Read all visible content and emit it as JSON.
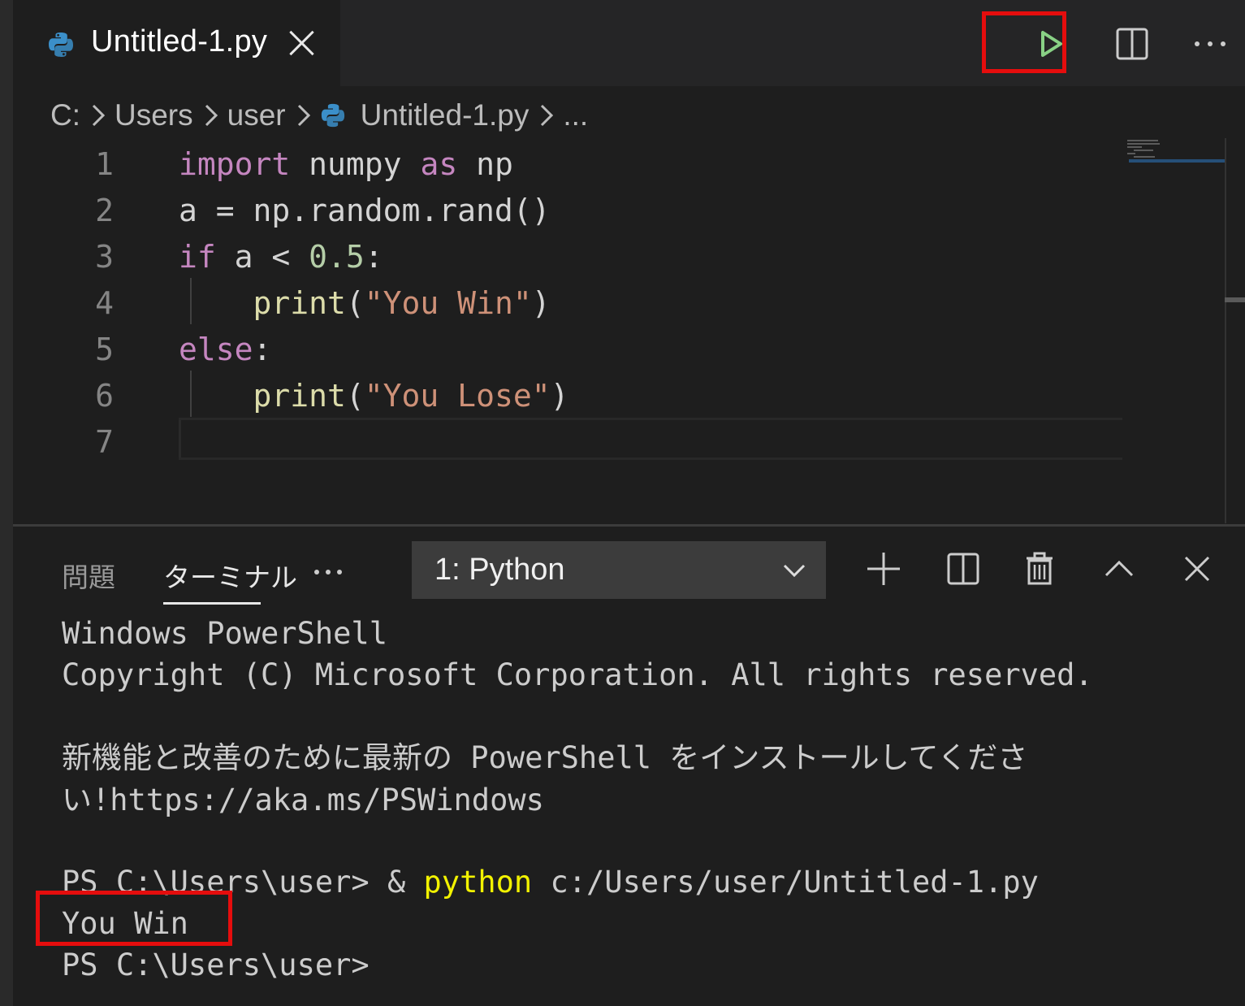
{
  "editor_tab": {
    "title": "Untitled-1.py"
  },
  "breadcrumb": [
    "C:",
    "Users",
    "user",
    "Untitled-1.py",
    "..."
  ],
  "code": {
    "line_numbers": [
      "1",
      "2",
      "3",
      "4",
      "5",
      "6",
      "7"
    ],
    "tokens": {
      "l1_import": "import",
      "l1_numpy": "numpy",
      "l1_as": "as",
      "l1_np": "np",
      "l2_text": "a = np.random.rand()",
      "l3_if": "if",
      "l3_cond": "a < ",
      "l3_num": "0.5",
      "l3_colon": ":",
      "l4_print": "print",
      "l4_open": "(",
      "l4_str": "\"You Win\"",
      "l4_close": ")",
      "l5_else": "else",
      "l5_colon": ":",
      "l6_print": "print",
      "l6_open": "(",
      "l6_str": "\"You Lose\"",
      "l6_close": ")"
    }
  },
  "panel": {
    "tabs": {
      "problems": "問題",
      "terminal": "ターミナル"
    },
    "terminal_select": "1: Python"
  },
  "terminal": {
    "line1": "Windows PowerShell",
    "line2": "Copyright (C) Microsoft Corporation. All rights reserved.",
    "line3": "新機能と改善のために最新の PowerShell をインストールしてください!https://aka.ms/PSWindows",
    "prompt1": "PS C:\\Users\\user> & ",
    "cmd": "python",
    "cmd_arg": " c:/Users/user/Untitled-1.py",
    "output": "You Win",
    "prompt2": "PS C:\\Users\\user>"
  },
  "colors": {
    "keyword": "#c586c0",
    "function": "#dcdcaa",
    "string": "#ce9178",
    "number": "#b5cea8",
    "highlight": "#e50d0d",
    "run": "#89d185"
  }
}
